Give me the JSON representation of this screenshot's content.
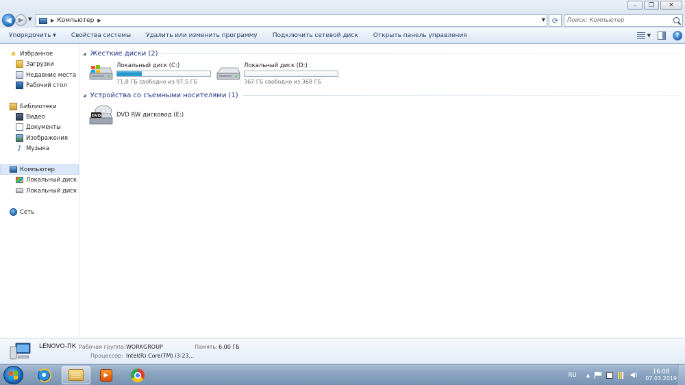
{
  "window": {
    "minimize_icon": "minimize-icon",
    "maximize_icon": "restore-icon",
    "close_icon": "close-icon"
  },
  "address": {
    "crumb": "Компьютер",
    "search_placeholder": "Поиск: Компьютер"
  },
  "toolbar": {
    "items": [
      "Упорядочить ▾",
      "Свойства системы",
      "Удалить или изменить программу",
      "Подключить сетевой диск",
      "Открыть панель управления"
    ]
  },
  "sidebar": {
    "favorites": "Избранное",
    "downloads": "Загрузки",
    "recent": "Недавние места",
    "desktop": "Рабочий стол",
    "libraries": "Библиотеки",
    "video": "Видео",
    "documents": "Документы",
    "images": "Изображения",
    "music": "Музыка",
    "computer": "Компьютер",
    "drive_c": "Локальный диск (C",
    "drive_d": "Локальный диск (D",
    "network": "Сеть"
  },
  "content": {
    "hdd_group": "Жесткие диски (2)",
    "removable_group": "Устройства со съемными носителями (1)",
    "drives": [
      {
        "name": "Локальный диск (C:)",
        "free": "71,8 ГБ свободно из 97,5 ГБ",
        "used_fraction": 0.264
      },
      {
        "name": "Локальный диск (D:)",
        "free": "367 ГБ свободно из 368 ГБ",
        "used_fraction": 0.003
      }
    ],
    "dvd_name": "DVD RW дисковод (E:)",
    "dvd_label": "DVD"
  },
  "details": {
    "pc_name": "LENOVO-ПК",
    "workgroup_label": "Рабочая группа:",
    "workgroup_value": "WORKGROUP",
    "memory_label": "Память:",
    "memory_value": "6,00 ГБ",
    "cpu_label": "Процессор:",
    "cpu_value": "Intel(R) Core(TM) i3-23..."
  },
  "taskbar": {
    "lang": "RU",
    "time": "16:08",
    "date": "07.03.2019"
  },
  "colors": {
    "drive_fill": "#1e8fc9",
    "group_title": "#1e3287"
  }
}
